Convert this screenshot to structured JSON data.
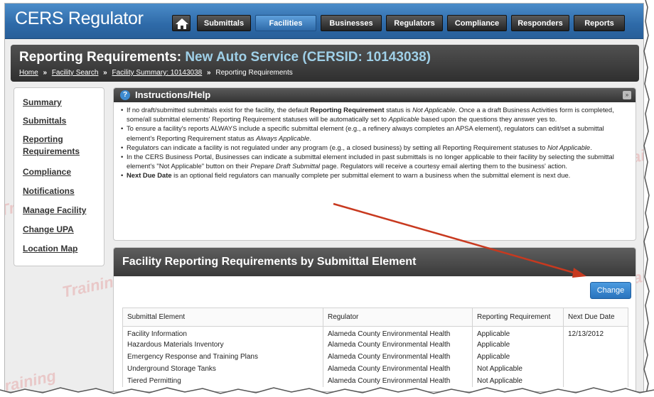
{
  "app": {
    "title": "CERS Regulator"
  },
  "nav": {
    "items": [
      {
        "label": "Submittals",
        "active": false
      },
      {
        "label": "Facilities",
        "active": true
      },
      {
        "label": "Businesses",
        "active": false
      },
      {
        "label": "Regulators",
        "active": false
      },
      {
        "label": "Compliance",
        "active": false
      },
      {
        "label": "Responders",
        "active": false
      },
      {
        "label": "Reports",
        "active": false
      }
    ]
  },
  "page": {
    "title": "Reporting Requirements:",
    "subtitle": "New Auto Service (CERSID: 10143038)",
    "breadcrumb": {
      "home": "Home",
      "facility_search": "Facility Search",
      "facility_summary": "Facility Summary: 10143038",
      "current": "Reporting Requirements",
      "sep": "»"
    }
  },
  "sidebar": {
    "items": [
      {
        "label": "Summary"
      },
      {
        "label": "Submittals"
      },
      {
        "label": "Reporting Requirements"
      },
      {
        "label": "Compliance"
      },
      {
        "label": "Notifications"
      },
      {
        "label": "Manage Facility"
      },
      {
        "label": "Change UPA"
      },
      {
        "label": "Location Map"
      }
    ]
  },
  "instructions": {
    "title": "Instructions/Help",
    "icon": "?",
    "collapse_icon": "»",
    "bullets": [
      {
        "parts": [
          "If no draft/submitted submittals exist for the facility, the default ",
          "Reporting Requirement",
          " status is ",
          "Not Applicable",
          ". Once a a draft Business Activities form is completed, some/all submittal elements' Reporting Requirement statuses will be automatically set to ",
          "Applicable",
          " based upon the questions they answer yes to."
        ]
      },
      {
        "parts": [
          "To ensure a facility's reports ALWAYS include a specific submittal element (e.g., a refinery always completes an APSA element), regulators can edit/set a submittal element's Reporting Requirement status as ",
          "Always Applicable",
          "."
        ]
      },
      {
        "parts": [
          "Regulators can indicate a facility is not regulated under any program (e.g., a closed business) by setting all Reporting Requirement statuses to ",
          "Not Applicable",
          "."
        ]
      },
      {
        "parts": [
          "In the CERS Business Portal, Businesses can indicate a submittal element included in past submittals is no longer applicable to their facility by selecting the submittal element's \"Not Applicable\" button on their ",
          "Prepare Draft Submittal",
          " page. Regulators will receive a courtesy email alerting them to the business' action."
        ]
      },
      {
        "parts": [
          "Next Due Date",
          " is an optional field regulators can manually complete per submittal element to warn a business when the submittal element is next due."
        ]
      }
    ]
  },
  "requirements": {
    "title": "Facility Reporting Requirements by Submittal Element",
    "change_label": "Change",
    "columns": [
      "Submittal Element",
      "Regulator",
      "Reporting Requirement",
      "Next Due Date"
    ],
    "rows": [
      [
        "Facility Information",
        "Alameda County Environmental Health",
        "Applicable",
        "12/13/2012"
      ],
      [
        "Hazardous Materials Inventory",
        "Alameda County Environmental Health",
        "Applicable",
        ""
      ],
      [
        "Emergency Response and Training Plans",
        "Alameda County Environmental Health",
        "Applicable",
        ""
      ],
      [
        "Underground Storage Tanks",
        "Alameda County Environmental Health",
        "Not Applicable",
        ""
      ],
      [
        "Tiered Permitting",
        "Alameda County Environmental Health",
        "Not Applicable",
        ""
      ]
    ]
  },
  "watermark": {
    "text": "Training"
  },
  "colors": {
    "brand_blue": "#2e6aa8",
    "header_dark": "#3a3a3a",
    "annotation_red": "#c8391f",
    "watermark_red": "#dc4646"
  }
}
